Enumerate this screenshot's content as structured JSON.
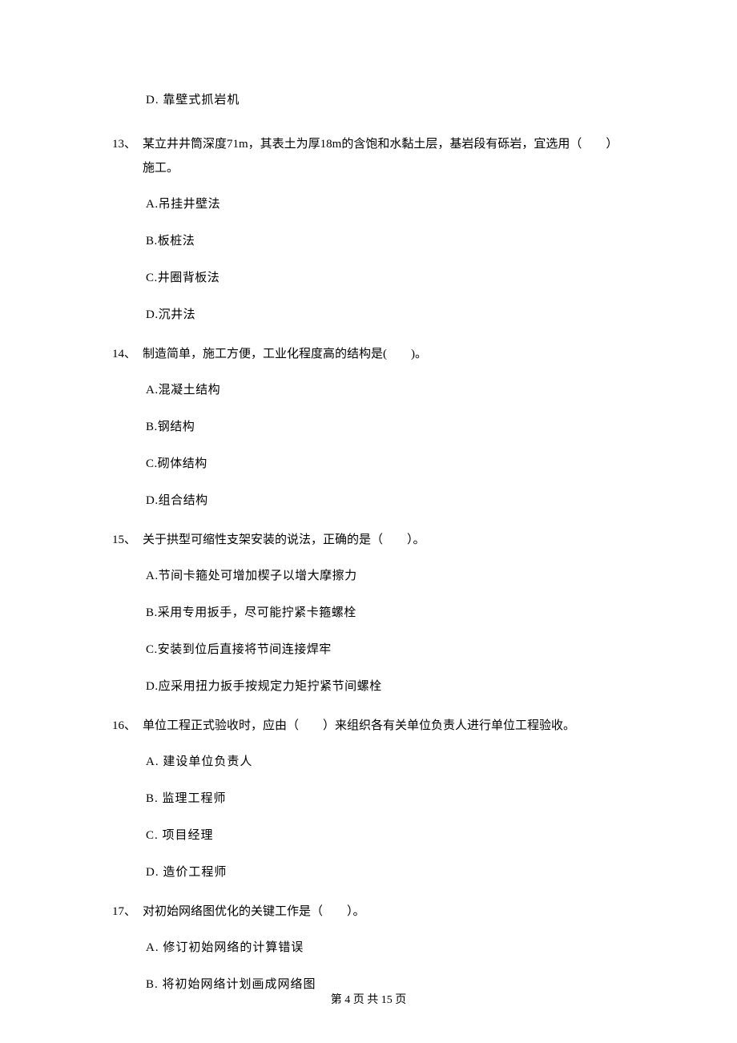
{
  "orphan_option_d": "D.  靠壁式抓岩机",
  "questions": [
    {
      "num": "13、",
      "stem": "某立井井筒深度71m，其表土为厚18m的含饱和水黏土层，基岩段有砾岩，宜选用（　　）施工。",
      "options": [
        "A.吊挂井壁法",
        "B.板桩法",
        "C.井圈背板法",
        "D.沉井法"
      ],
      "spaced": false
    },
    {
      "num": "14、",
      "stem": "制造简单，施工方便，工业化程度高的结构是(　　)。",
      "options": [
        "A.混凝土结构",
        "B.钢结构",
        "C.砌体结构",
        "D.组合结构"
      ],
      "spaced": false
    },
    {
      "num": "15、",
      "stem": "关于拱型可缩性支架安装的说法，正确的是（　　）。",
      "options": [
        "A.节间卡箍处可增加楔子以增大摩擦力",
        "B.采用专用扳手，尽可能拧紧卡箍螺栓",
        "C.安装到位后直接将节间连接焊牢",
        "D.应采用扭力扳手按规定力矩拧紧节间螺栓"
      ],
      "spaced": false
    },
    {
      "num": "16、",
      "stem": "单位工程正式验收时，应由（　　）来组织各有关单位负责人进行单位工程验收。",
      "options": [
        "A.  建设单位负责人",
        "B.  监理工程师",
        "C.  项目经理",
        "D.  造价工程师"
      ],
      "spaced": true
    },
    {
      "num": "17、",
      "stem": "对初始网络图优化的关键工作是（　　）。",
      "options": [
        "A.  修订初始网络的计算错误",
        "B.  将初始网络计划画成网络图"
      ],
      "spaced": true
    }
  ],
  "footer": "第 4 页 共 15 页"
}
